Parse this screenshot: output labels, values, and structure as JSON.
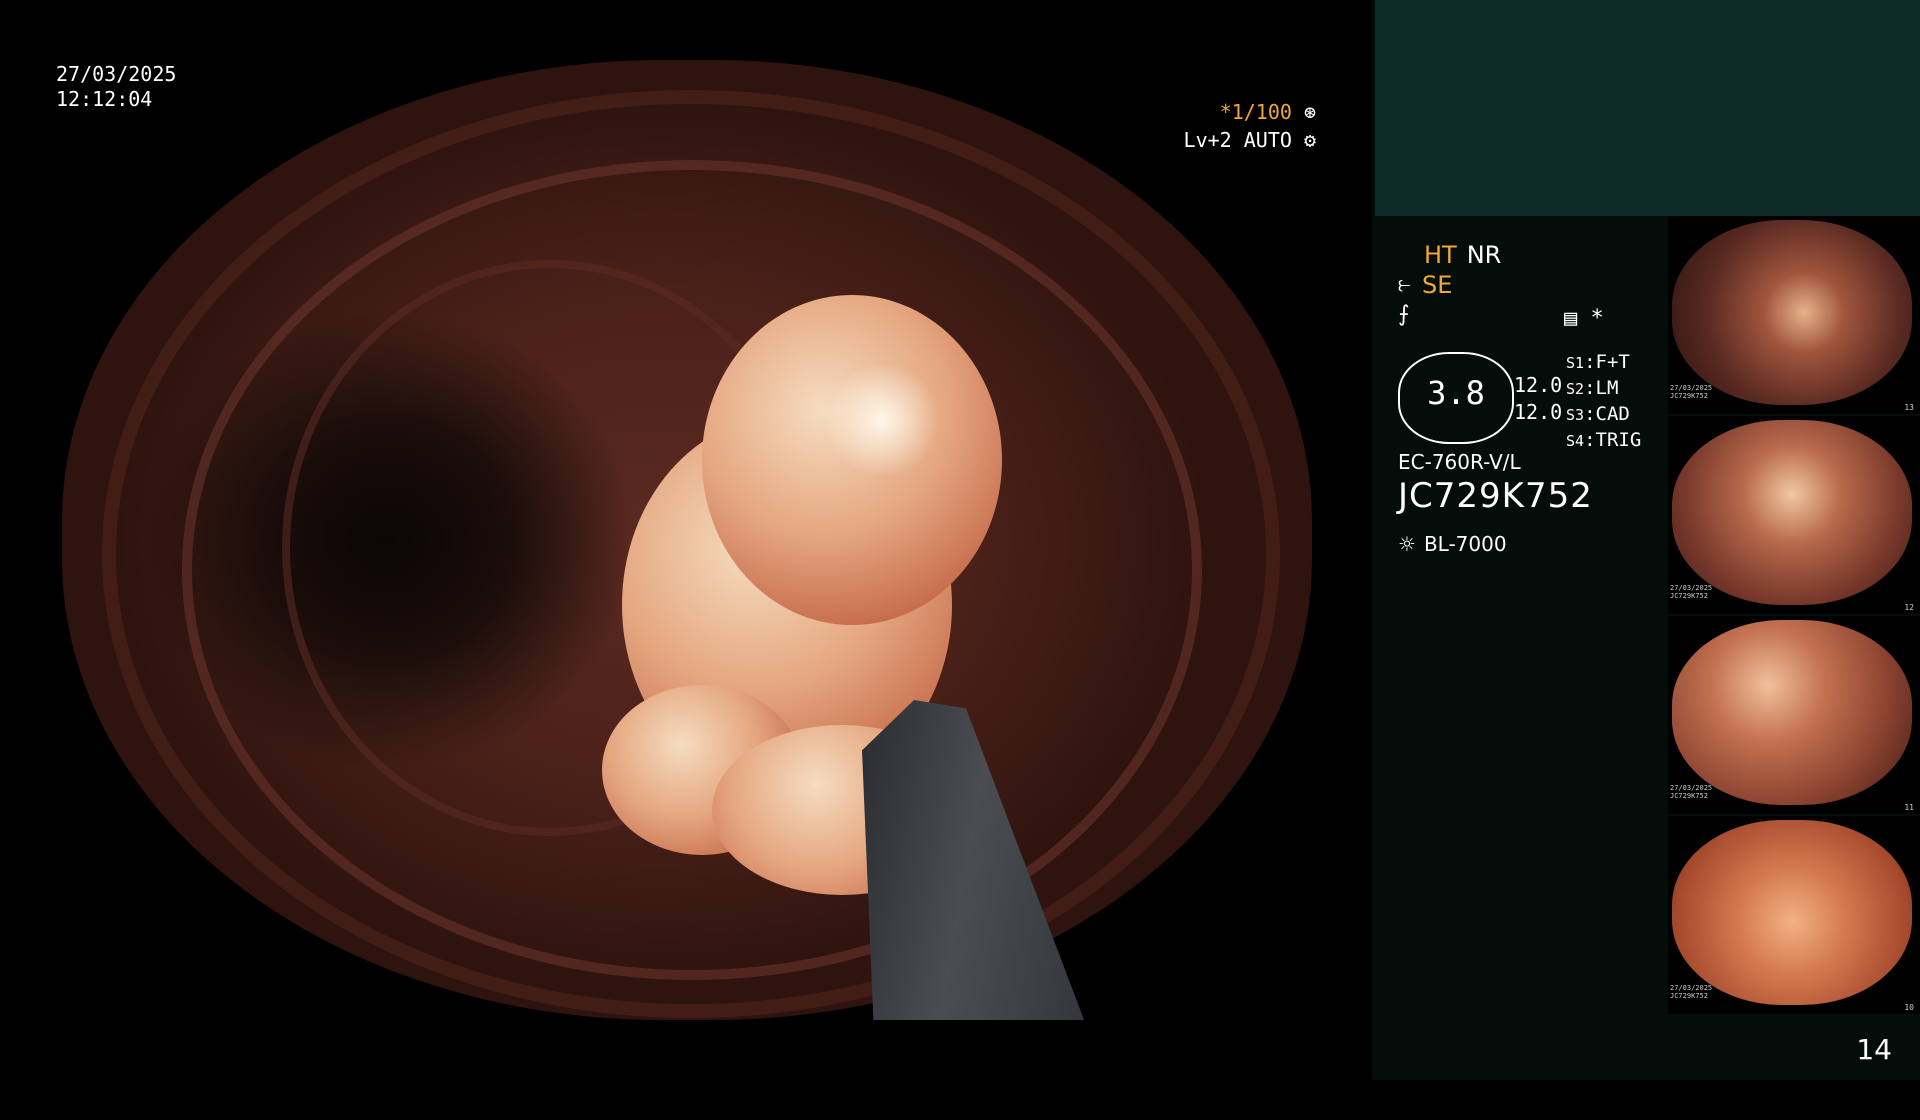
{
  "main": {
    "date": "27/03/2025",
    "time": "12:12:04",
    "shutter": "*1/100",
    "level": "Lv+2 AUTO"
  },
  "info": {
    "ht": "HT",
    "nr": "NR",
    "se": "SE",
    "gauge_value": "3.8",
    "gauge_pair": [
      "12.0",
      "12.0"
    ],
    "switches": [
      {
        "key": "S1",
        "value": "F+T"
      },
      {
        "key": "S2",
        "value": "LM"
      },
      {
        "key": "S3",
        "value": "CAD"
      },
      {
        "key": "S4",
        "value": "TRIG"
      }
    ],
    "asterisk": "*",
    "model": "EC-760R-V/L",
    "serial": "JC729K752",
    "light_source": "BL-7000",
    "page_number": "14"
  },
  "thumbnails": [
    {
      "date": "27/03/2025",
      "serial": "JC729K752",
      "index": "13"
    },
    {
      "date": "27/03/2025",
      "serial": "JC729K752",
      "index": "12"
    },
    {
      "date": "27/03/2025",
      "serial": "JC729K752",
      "index": "11"
    },
    {
      "date": "27/03/2025",
      "serial": "JC729K752",
      "index": "10"
    }
  ],
  "colors": {
    "accent": "#f0a830",
    "panel_top": "#0e2b27",
    "panel": "#050d0b"
  },
  "icons": [
    "aperture-icon",
    "gear-icon",
    "scope-icon",
    "wave-icon",
    "settings-card-icon",
    "sun-icon"
  ]
}
